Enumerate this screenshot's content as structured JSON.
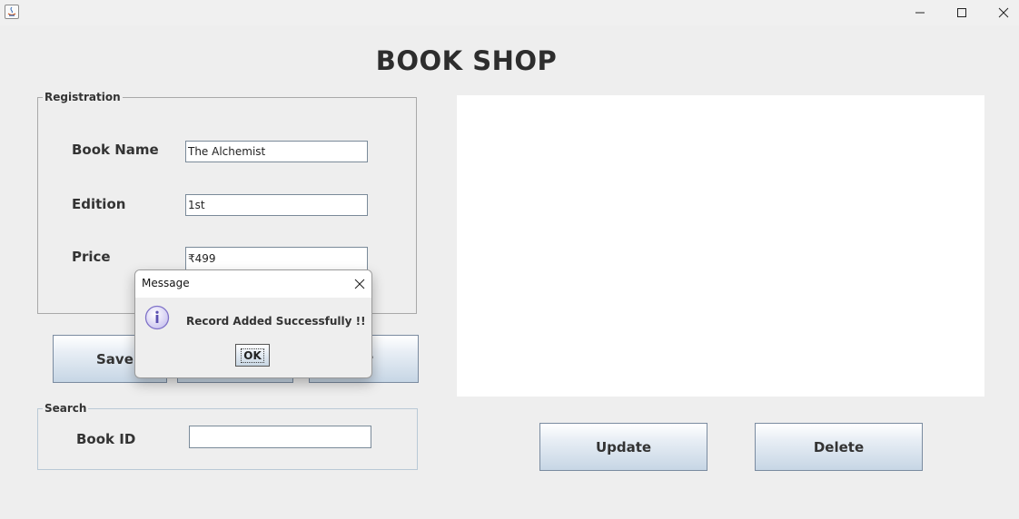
{
  "window": {
    "controls": [
      "minimize-icon",
      "maximize-icon",
      "close-icon"
    ]
  },
  "header": {
    "title": "BOOK SHOP"
  },
  "registration": {
    "legend": "Registration",
    "book_name_label": "Book Name",
    "book_name_value": "The Alchemist",
    "edition_label": "Edition",
    "edition_value": "1st",
    "price_label": "Price",
    "price_value": "₹499"
  },
  "actions": {
    "save_label": "Save",
    "exit_label": "",
    "clear_label_visible": "ar"
  },
  "search": {
    "legend": "Search",
    "book_id_label": "Book ID",
    "book_id_value": ""
  },
  "table_actions": {
    "update_label": "Update",
    "delete_label": "Delete"
  },
  "dialog": {
    "title": "Message",
    "message": "Record Added Successfully !!",
    "ok_label": "OK",
    "icon": "info-icon"
  },
  "colors": {
    "background": "#eeeeee",
    "button_gradient_top": "#ffffff",
    "button_gradient_bottom": "#c7d6e5",
    "info_icon": "#7f72c8"
  }
}
